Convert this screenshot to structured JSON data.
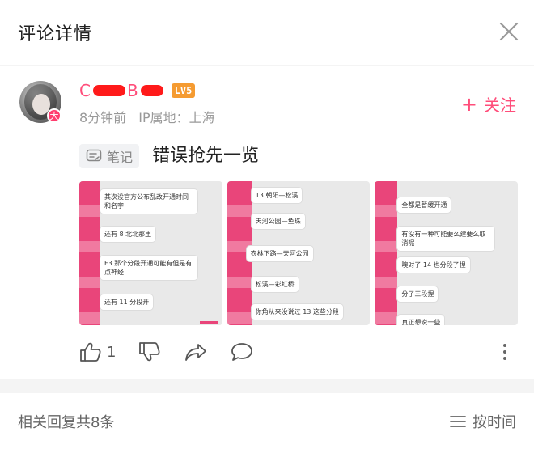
{
  "header": {
    "title": "评论详情"
  },
  "comment": {
    "username_prefix": "C",
    "username_mid": "B",
    "level": "LV5",
    "avatar_badge": "大",
    "time": "8分钟前",
    "ip": "IP属地：上海",
    "follow_label": "关注",
    "note_tag": "笔记",
    "text": "错误抢先一览",
    "likes": "1",
    "images": [
      {
        "bubbles": [
          "其次没官方公布乱改开通时间和名字",
          "还有 8 北北那里",
          "F3 那个分段开通可能有但是有点神经",
          "还有 11 分段开"
        ]
      },
      {
        "bubbles": [
          "13 朝阳—松溪",
          "天河公园—鱼珠",
          "农林下路—天河公园",
          "松溪—彩虹桥",
          "你角从来没说过 13 这些分段"
        ]
      },
      {
        "bubbles": [
          "全都是暂缓开通",
          "有没有一种可能要么建要么取消呢",
          "噢对了 14 也分段了捏",
          "分了三段捏",
          "真正想说一些"
        ]
      }
    ]
  },
  "footer": {
    "reply_count": "相关回复共8条",
    "sort_label": "按时间"
  },
  "colors": {
    "accent": "#ff4d7a",
    "level": "#f59b31"
  }
}
